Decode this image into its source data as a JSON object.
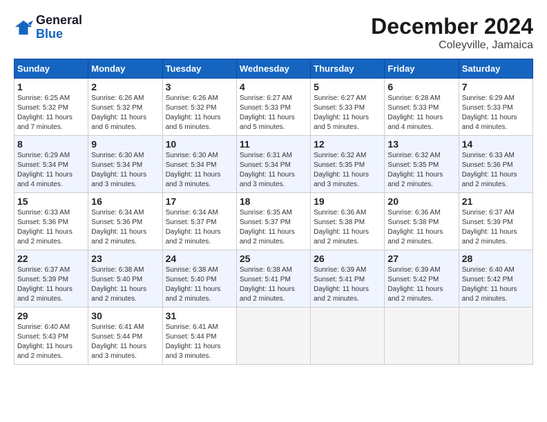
{
  "header": {
    "logo_line1": "General",
    "logo_line2": "Blue",
    "month": "December 2024",
    "location": "Coleyville, Jamaica"
  },
  "weekdays": [
    "Sunday",
    "Monday",
    "Tuesday",
    "Wednesday",
    "Thursday",
    "Friday",
    "Saturday"
  ],
  "weeks": [
    [
      {
        "day": "1",
        "sunrise": "6:25 AM",
        "sunset": "5:32 PM",
        "daylight": "11 hours and 7 minutes."
      },
      {
        "day": "2",
        "sunrise": "6:26 AM",
        "sunset": "5:32 PM",
        "daylight": "11 hours and 6 minutes."
      },
      {
        "day": "3",
        "sunrise": "6:26 AM",
        "sunset": "5:32 PM",
        "daylight": "11 hours and 6 minutes."
      },
      {
        "day": "4",
        "sunrise": "6:27 AM",
        "sunset": "5:33 PM",
        "daylight": "11 hours and 5 minutes."
      },
      {
        "day": "5",
        "sunrise": "6:27 AM",
        "sunset": "5:33 PM",
        "daylight": "11 hours and 5 minutes."
      },
      {
        "day": "6",
        "sunrise": "6:28 AM",
        "sunset": "5:33 PM",
        "daylight": "11 hours and 4 minutes."
      },
      {
        "day": "7",
        "sunrise": "6:29 AM",
        "sunset": "5:33 PM",
        "daylight": "11 hours and 4 minutes."
      }
    ],
    [
      {
        "day": "8",
        "sunrise": "6:29 AM",
        "sunset": "5:34 PM",
        "daylight": "11 hours and 4 minutes."
      },
      {
        "day": "9",
        "sunrise": "6:30 AM",
        "sunset": "5:34 PM",
        "daylight": "11 hours and 3 minutes."
      },
      {
        "day": "10",
        "sunrise": "6:30 AM",
        "sunset": "5:34 PM",
        "daylight": "11 hours and 3 minutes."
      },
      {
        "day": "11",
        "sunrise": "6:31 AM",
        "sunset": "5:34 PM",
        "daylight": "11 hours and 3 minutes."
      },
      {
        "day": "12",
        "sunrise": "6:32 AM",
        "sunset": "5:35 PM",
        "daylight": "11 hours and 3 minutes."
      },
      {
        "day": "13",
        "sunrise": "6:32 AM",
        "sunset": "5:35 PM",
        "daylight": "11 hours and 2 minutes."
      },
      {
        "day": "14",
        "sunrise": "6:33 AM",
        "sunset": "5:36 PM",
        "daylight": "11 hours and 2 minutes."
      }
    ],
    [
      {
        "day": "15",
        "sunrise": "6:33 AM",
        "sunset": "5:36 PM",
        "daylight": "11 hours and 2 minutes."
      },
      {
        "day": "16",
        "sunrise": "6:34 AM",
        "sunset": "5:36 PM",
        "daylight": "11 hours and 2 minutes."
      },
      {
        "day": "17",
        "sunrise": "6:34 AM",
        "sunset": "5:37 PM",
        "daylight": "11 hours and 2 minutes."
      },
      {
        "day": "18",
        "sunrise": "6:35 AM",
        "sunset": "5:37 PM",
        "daylight": "11 hours and 2 minutes."
      },
      {
        "day": "19",
        "sunrise": "6:36 AM",
        "sunset": "5:38 PM",
        "daylight": "11 hours and 2 minutes."
      },
      {
        "day": "20",
        "sunrise": "6:36 AM",
        "sunset": "5:38 PM",
        "daylight": "11 hours and 2 minutes."
      },
      {
        "day": "21",
        "sunrise": "6:37 AM",
        "sunset": "5:39 PM",
        "daylight": "11 hours and 2 minutes."
      }
    ],
    [
      {
        "day": "22",
        "sunrise": "6:37 AM",
        "sunset": "5:39 PM",
        "daylight": "11 hours and 2 minutes."
      },
      {
        "day": "23",
        "sunrise": "6:38 AM",
        "sunset": "5:40 PM",
        "daylight": "11 hours and 2 minutes."
      },
      {
        "day": "24",
        "sunrise": "6:38 AM",
        "sunset": "5:40 PM",
        "daylight": "11 hours and 2 minutes."
      },
      {
        "day": "25",
        "sunrise": "6:38 AM",
        "sunset": "5:41 PM",
        "daylight": "11 hours and 2 minutes."
      },
      {
        "day": "26",
        "sunrise": "6:39 AM",
        "sunset": "5:41 PM",
        "daylight": "11 hours and 2 minutes."
      },
      {
        "day": "27",
        "sunrise": "6:39 AM",
        "sunset": "5:42 PM",
        "daylight": "11 hours and 2 minutes."
      },
      {
        "day": "28",
        "sunrise": "6:40 AM",
        "sunset": "5:42 PM",
        "daylight": "11 hours and 2 minutes."
      }
    ],
    [
      {
        "day": "29",
        "sunrise": "6:40 AM",
        "sunset": "5:43 PM",
        "daylight": "11 hours and 2 minutes."
      },
      {
        "day": "30",
        "sunrise": "6:41 AM",
        "sunset": "5:44 PM",
        "daylight": "11 hours and 3 minutes."
      },
      {
        "day": "31",
        "sunrise": "6:41 AM",
        "sunset": "5:44 PM",
        "daylight": "11 hours and 3 minutes."
      },
      null,
      null,
      null,
      null
    ]
  ]
}
